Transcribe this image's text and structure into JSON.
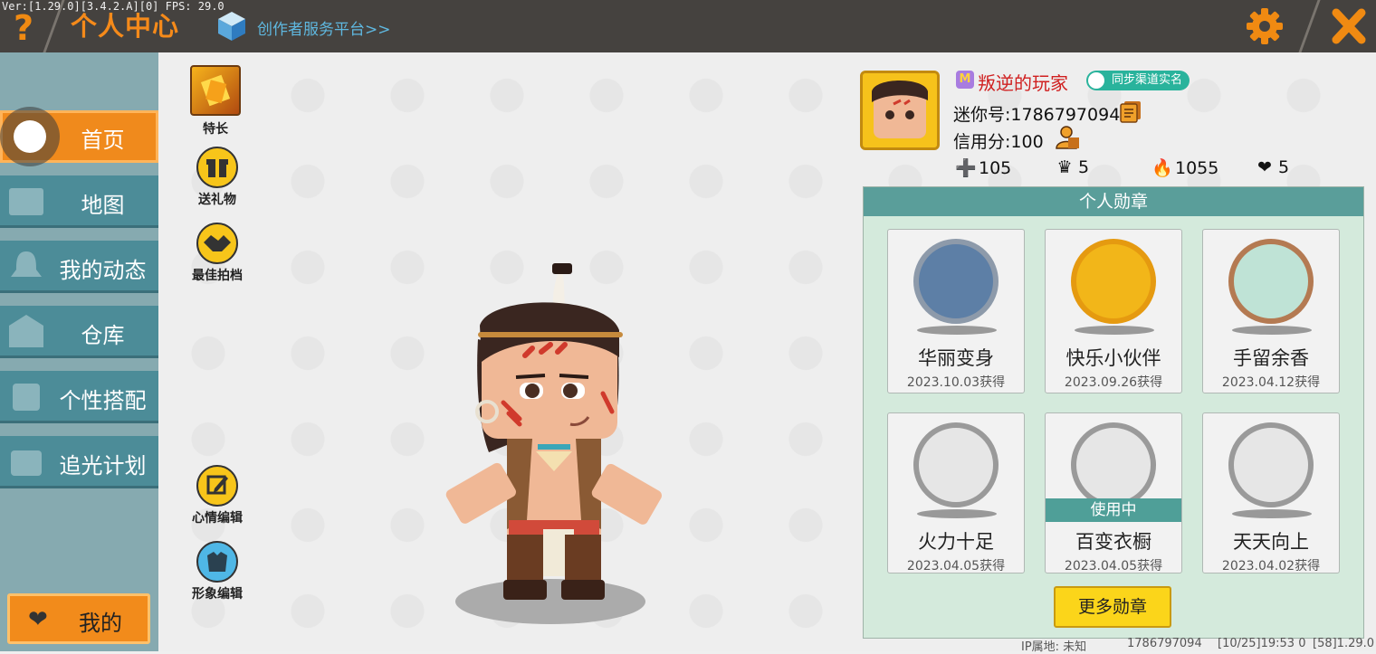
{
  "debug_info": "Ver:[1.29.0][3.4.2.A][0] FPS: 29.0",
  "header": {
    "help_glyph": "?",
    "title": "个人中心",
    "creator_link": "创作者服务平台>>",
    "accent_color": "#f58a1a"
  },
  "sidebar": {
    "items": [
      {
        "label": "首页",
        "icon": "home-icon",
        "active": true
      },
      {
        "label": "地图",
        "icon": "map-icon",
        "active": false
      },
      {
        "label": "我的动态",
        "icon": "bell-icon",
        "active": false
      },
      {
        "label": "仓库",
        "icon": "warehouse-icon",
        "active": false
      },
      {
        "label": "个性搭配",
        "icon": "outfit-icon",
        "active": false
      },
      {
        "label": "追光计划",
        "icon": "light-plan-icon",
        "active": false
      }
    ],
    "my_button": "我的"
  },
  "actions": {
    "specialty": "特长",
    "gift": "送礼物",
    "partner": "最佳拍档",
    "mood_edit": "心情编辑",
    "image_edit": "形象编辑"
  },
  "profile": {
    "username": "叛逆的玩家",
    "sync_badge": "同步渠道实名",
    "mini_id": "迷你号:1786797094",
    "credit": "信用分:100",
    "stats": {
      "friends": "105",
      "fans": "5",
      "popularity": "1055",
      "likes": "5"
    }
  },
  "medals": {
    "title": "个人勋章",
    "items": [
      {
        "name": "华丽变身",
        "date": "2023.10.03获得",
        "in_use": false,
        "color": "#5d7fa6"
      },
      {
        "name": "快乐小伙伴",
        "date": "2023.09.26获得",
        "in_use": false,
        "color": "#f2b619"
      },
      {
        "name": "手留余香",
        "date": "2023.04.12获得",
        "in_use": false,
        "color": "#b47a52"
      },
      {
        "name": "火力十足",
        "date": "2023.04.05获得",
        "in_use": false,
        "color": "#a5a5a5"
      },
      {
        "name": "百变衣橱",
        "date": "2023.04.05获得",
        "in_use": true,
        "color": "#a5a5a5"
      },
      {
        "name": "天天向上",
        "date": "2023.04.02获得",
        "in_use": false,
        "color": "#a5a5a5"
      }
    ],
    "in_use_label": "使用中",
    "more_button": "更多勋章"
  },
  "footer": {
    "ip": "IP属地: 未知",
    "uid": "1786797094",
    "time": "[10/25]19:53 0",
    "version": "[58]1.29.0"
  }
}
